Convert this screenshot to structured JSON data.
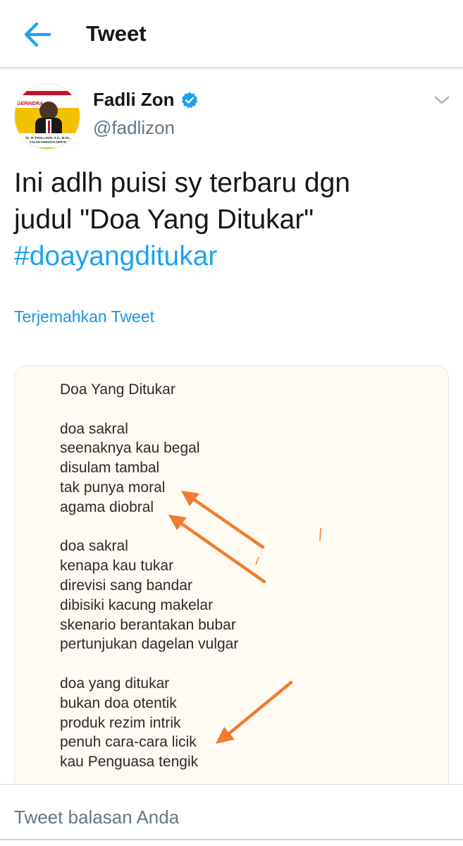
{
  "header": {
    "title": "Tweet"
  },
  "tweet": {
    "author_name": "Fadli Zon",
    "author_handle": "@fadlizon",
    "text_line1": "Ini adlh puisi sy terbaru dgn",
    "text_line2": "judul \"Doa Yang Ditukar\"",
    "hashtag": "#doayangditukar",
    "translate_label": "Terjemahkan Tweet"
  },
  "media": {
    "poem": "Doa Yang Ditukar\n\ndoa sakral\nseenaknya kau begal\ndisulam tambal\ntak punya moral\nagama diobral\n\ndoa sakral\nkenapa kau tukar\ndirevisi sang bandar\ndibisiki kacung makelar\nskenario berantakan bubar\npertunjukan dagelan vulgar\n\ndoa yang ditukar\nbukan doa otentik\nproduk rezim intrik\npenuh cara-cara licik\nkau Penguasa tengik",
    "arrow_color": "#f07d2c"
  },
  "avatar": {
    "banner_text": "GERINDRA",
    "caption_line1": "Dr. H. FADLI ZON, S.S., M.Sc.",
    "caption_line2": "CALON ANGGOTA DPR RI"
  },
  "reply": {
    "placeholder": "Tweet balasan Anda"
  },
  "colors": {
    "accent": "#1da1f2",
    "verified": "#1da1f2"
  },
  "icons": {
    "back": "back-arrow-icon",
    "verified": "verified-badge-icon",
    "more": "chevron-down-icon"
  }
}
